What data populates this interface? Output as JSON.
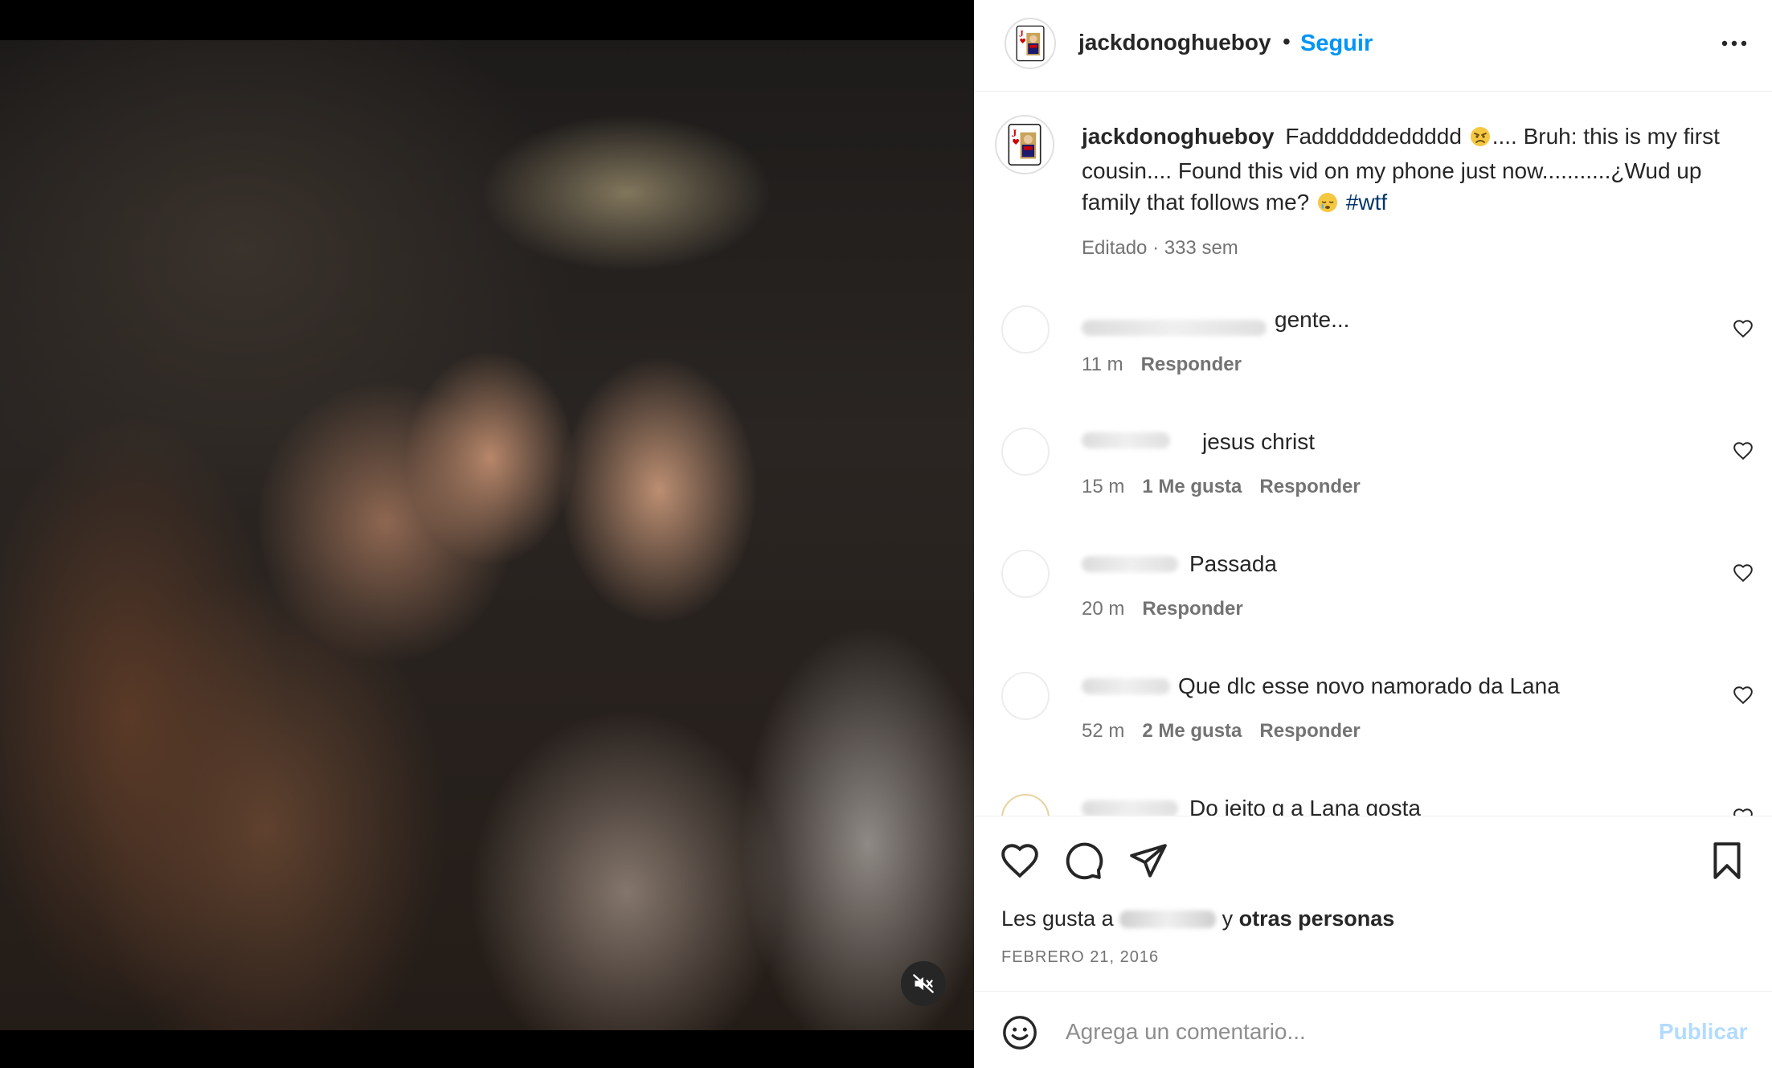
{
  "post": {
    "username": "jackdonoghueboy",
    "follow_label": "Seguir",
    "separator": "•"
  },
  "caption": {
    "username": "jackdonoghueboy",
    "text_1": "Faddddddeddddd",
    "text_2": ".... Bruh: this is my first cousin.... Found this vid on my phone just now...........¿Wud up family that follows me?",
    "hashtag": "#wtf",
    "meta": "Editado · 333 sem"
  },
  "comments": [
    {
      "text": "gente...",
      "time": "11 m",
      "likes": "",
      "reply": "Responder"
    },
    {
      "text": "jesus christ",
      "time": "15 m",
      "likes": "1 Me gusta",
      "reply": "Responder"
    },
    {
      "text": "Passada",
      "time": "20 m",
      "likes": "",
      "reply": "Responder"
    },
    {
      "text": "Que dlc esse novo namorado da Lana",
      "time": "52 m",
      "likes": "2 Me gusta",
      "reply": "Responder"
    },
    {
      "text": "Do jeito q a Lana gosta",
      "time": "",
      "likes": "",
      "reply": ""
    }
  ],
  "likes": {
    "prefix": "Les gusta a",
    "suffix_conj": "y",
    "suffix_bold": "otras personas"
  },
  "date": "FEBRERO 21, 2016",
  "composer": {
    "placeholder": "Agrega un comentario...",
    "publish_label": "Publicar"
  },
  "icons": {
    "mute": "speaker-muted-icon",
    "more": "more-horizontal-icon",
    "like": "heart-icon",
    "comment": "comment-bubble-icon",
    "share": "paper-plane-icon",
    "save": "bookmark-icon",
    "emoji": "smiley-icon"
  },
  "colors": {
    "accent": "#0095f6",
    "hashtag": "#00376b",
    "publish_disabled": "#b3dbff",
    "secondary_text": "#737373"
  }
}
